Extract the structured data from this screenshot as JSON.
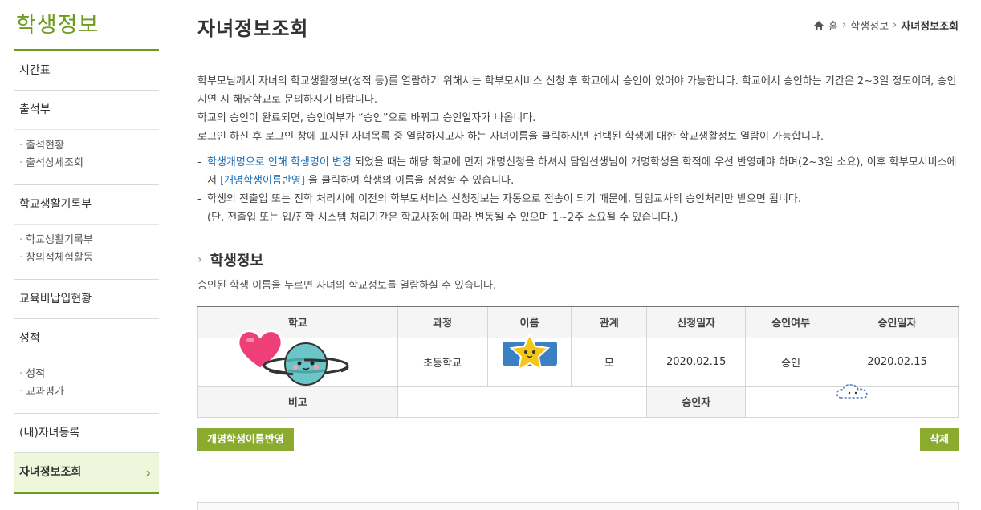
{
  "sidebar": {
    "title": "학생정보",
    "items": [
      {
        "label": "시간표"
      },
      {
        "label": "출석부",
        "subs": [
          "출석현황",
          "출석상세조회"
        ]
      },
      {
        "label": "학교생활기록부",
        "subs": [
          "학교생활기록부",
          "창의적체험활동"
        ]
      },
      {
        "label": "교육비납입현황"
      },
      {
        "label": "성적",
        "subs": [
          "성적",
          "교과평가"
        ]
      },
      {
        "label": "(내)자녀등록"
      },
      {
        "label": "자녀정보조회",
        "active": true
      }
    ]
  },
  "header": {
    "title": "자녀정보조회",
    "breadcrumb": [
      "홈",
      "학생정보",
      "자녀정보조회"
    ]
  },
  "intro": {
    "p1": "학부모님께서 자녀의 학교생활정보(성적 등)를 열람하기 위해서는 학부모서비스 신청 후 학교에서 승인이 있어야 가능합니다. 학교에서 승인하는 기간은 2~3일 정도이며, 승인지연 시 해당학교로 문의하시기 바랍니다.",
    "p2": "학교의 승인이 완료되면, 승인여부가 “승인”으로 바뀌고 승인일자가 나옵니다.",
    "p3": "로그인 하신 후 로그인 창에 표시된 자녀목록 중 열람하시고자 하는 자녀이름을 클릭하시면 선택된 학생에 대한 학교생활정보 열람이 가능합니다."
  },
  "notes": {
    "n1_blue": "학생개명으로 인해 학생명이 변경",
    "n1_text": " 되었을 때는 해당 학교에 먼저 개명신청을 하셔서 담임선생님이 개명학생을 학적에 우선 반영해야 하며(2~3일 소요), 이후 학부모서비스에서 ",
    "n1_link": "[개명학생이름반영]",
    "n1_tail": " 을 클릭하여 학생의 이름을 정정할 수 있습니다.",
    "n2": "학생의 전출입 또는 진학 처리시에 이전의 학부모서비스 신청정보는 자동으로 전송이 되기 때문에, 담임교사의 승인처리만 받으면 됩니다.",
    "n2b": "(단, 전출입 또는 입/진학 시스템 처리기간은 학교사정에 따라 변동될 수 있으며 1~2주 소요될 수 있습니다.)"
  },
  "section": {
    "title": "학생정보",
    "desc": "승인된 학생 이름을 누르면 자녀의 학교정보를 열람하실 수 있습니다."
  },
  "table": {
    "headers": [
      "학교",
      "과정",
      "이름",
      "관계",
      "신청일자",
      "승인여부",
      "승인일자"
    ],
    "row": {
      "school": "",
      "course": "초등학교",
      "name": "",
      "relation": "모",
      "apply_date": "2020.02.15",
      "status": "승인",
      "approve_date": "2020.02.15"
    },
    "remark_label": "비고",
    "remark_value": "",
    "approver_label": "승인자",
    "approver_value": ""
  },
  "buttons": {
    "rename": "개명학생이름반영",
    "delete": "삭제"
  },
  "colors": {
    "accent": "#6e9a1f",
    "button": "#8bab2f",
    "link": "#1e6fb3"
  },
  "icons": [
    "home-icon",
    "chevron-right-icon",
    "heart-sticker",
    "planet-sticker",
    "star-sticker",
    "cloud-sticker"
  ]
}
